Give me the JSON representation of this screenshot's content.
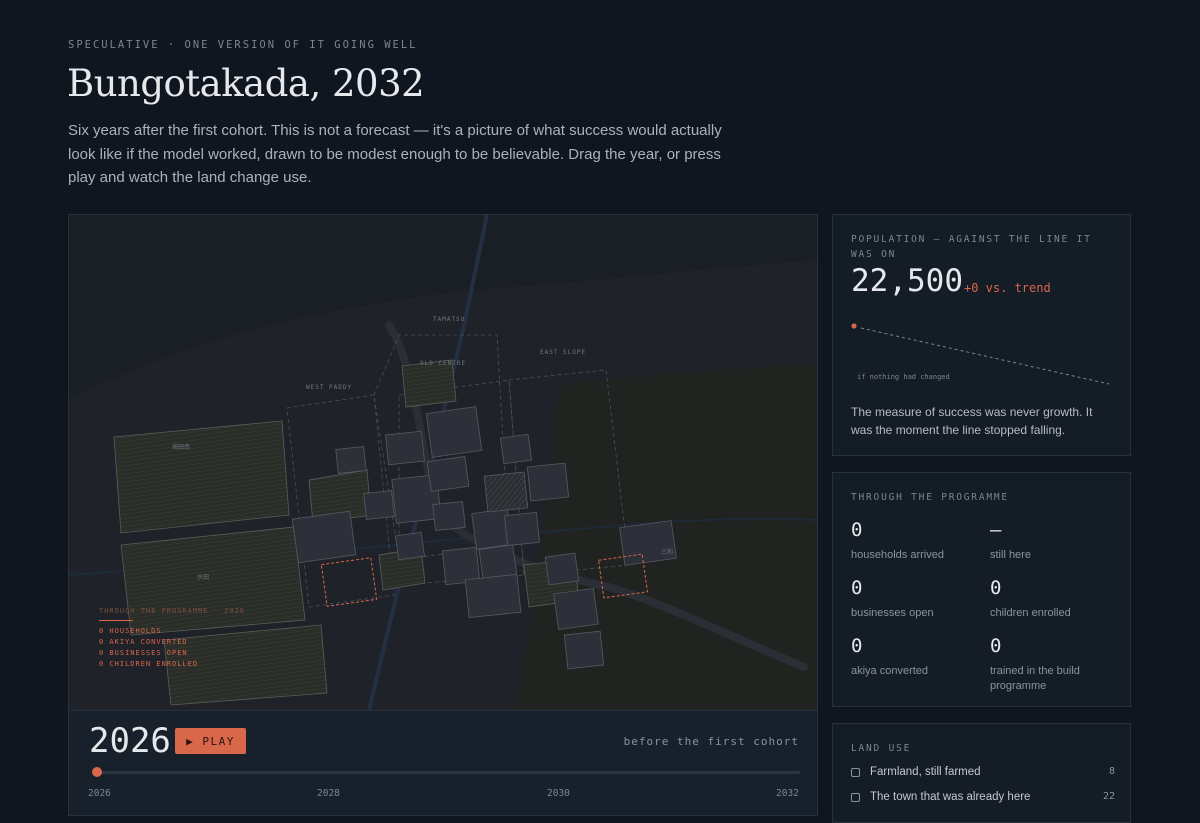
{
  "header": {
    "eyebrow": "SPECULATIVE · ONE VERSION OF IT GOING WELL",
    "title": "Bungotakada, 2032",
    "intro": "Six years after the first cohort. This is not a forecast — it's a picture of what success would actually look like if the model worked, drawn to be modest enough to be believable. Drag the year, or press play and watch the land change use."
  },
  "map": {
    "district_labels": [
      "TAMATSU",
      "OLD CENTRE",
      "EAST SLOPE",
      "WEST PADDY"
    ],
    "kanji_labels": [
      "高田南",
      "水田",
      "三和"
    ],
    "overlay": {
      "title": "THROUGH THE PROGRAMME · 2026",
      "lines": [
        "0 HOUSEHOLDS",
        "0 AKIYA CONVERTED",
        "0 BUSINESSES OPEN",
        "0 CHILDREN ENROLLED"
      ]
    }
  },
  "timeline": {
    "year": "2026",
    "play_label": "▶ PLAY",
    "phase": "before the first cohort",
    "position": 0,
    "ticks": [
      "2026",
      "2028",
      "2030",
      "2032"
    ]
  },
  "population": {
    "label": "POPULATION — AGAINST THE LINE IT WAS ON",
    "value": "22,500",
    "delta": "+0 vs. trend",
    "trend_note": "if nothing had changed",
    "text": "The measure of success was never growth. It was the moment the line stopped falling."
  },
  "programme": {
    "label": "THROUGH THE PROGRAMME",
    "stats": [
      {
        "value": "0",
        "label": "households arrived"
      },
      {
        "value": "—",
        "label": "still here"
      },
      {
        "value": "0",
        "label": "businesses open"
      },
      {
        "value": "0",
        "label": "children enrolled"
      },
      {
        "value": "0",
        "label": "akiya converted"
      },
      {
        "value": "0",
        "label": "trained in the build programme"
      }
    ]
  },
  "land_use": {
    "label": "LAND USE",
    "items": [
      {
        "label": "Farmland, still farmed",
        "count": "8"
      },
      {
        "label": "The town that was already here",
        "count": "22"
      }
    ]
  },
  "colors": {
    "accent": "#d9674a",
    "background": "#0f1620",
    "panel": "#141c26"
  }
}
